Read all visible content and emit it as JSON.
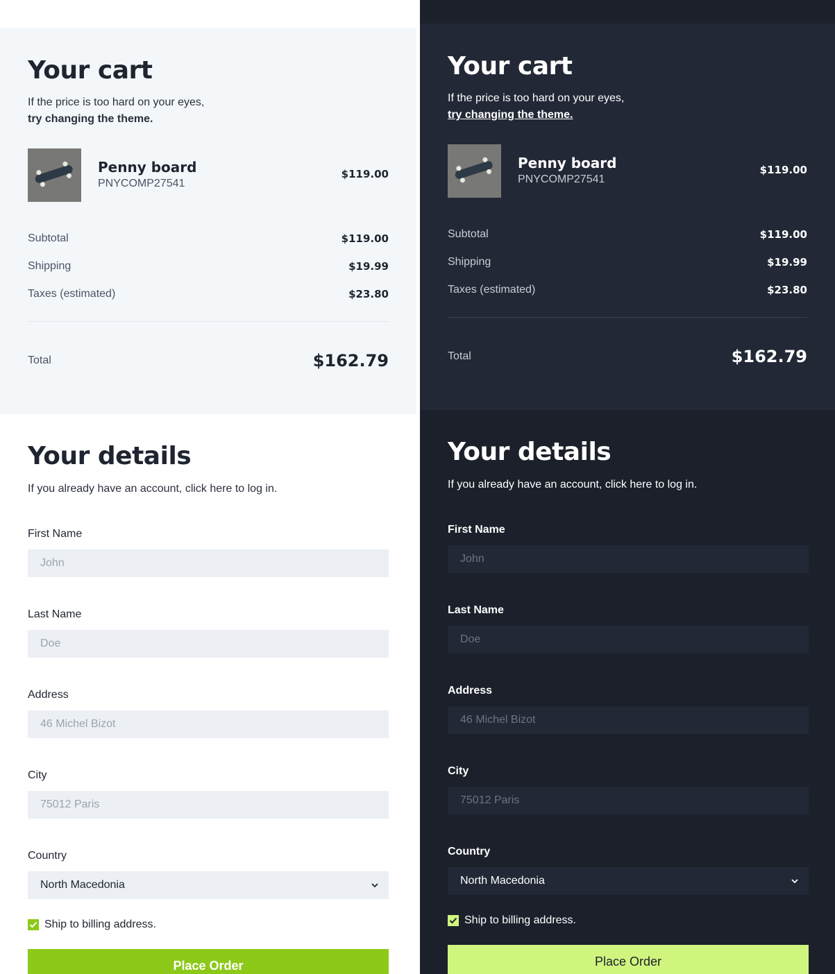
{
  "cart": {
    "title": "Your cart",
    "subtitle_line1": "If the price is too hard on your eyes,",
    "theme_link": "try changing the theme.",
    "item": {
      "name": "Penny board",
      "sku": "PNYCOMP27541",
      "price": "$119.00",
      "image_icon": "skateboard-image"
    },
    "lines": [
      {
        "label": "Subtotal",
        "value": "$119.00"
      },
      {
        "label": "Shipping",
        "value": "$19.99"
      },
      {
        "label": "Taxes (estimated)",
        "value": "$23.80"
      }
    ],
    "total": {
      "label": "Total",
      "value": "$162.79"
    }
  },
  "details": {
    "title": "Your details",
    "subtitle": "If you already have an account, click here to log in.",
    "fields": {
      "first_name": {
        "label": "First Name",
        "placeholder": "John"
      },
      "last_name": {
        "label": "Last Name",
        "placeholder": "Doe"
      },
      "address": {
        "label": "Address",
        "placeholder": "46 Michel Bizot"
      },
      "city": {
        "label": "City",
        "placeholder": "75012 Paris"
      }
    },
    "country": {
      "label": "Country",
      "selected": "North Macedonia"
    },
    "ship_billing": {
      "label": "Ship to billing address.",
      "checked": true
    },
    "place_order": "Place Order"
  },
  "themes": {
    "light": {
      "background": "#ffffff",
      "cart_bg": "#f4f7fa",
      "accent": "#8cc919"
    },
    "dark": {
      "background": "#1b202b",
      "cart_bg": "#222836",
      "accent": "#d0f57e"
    }
  }
}
